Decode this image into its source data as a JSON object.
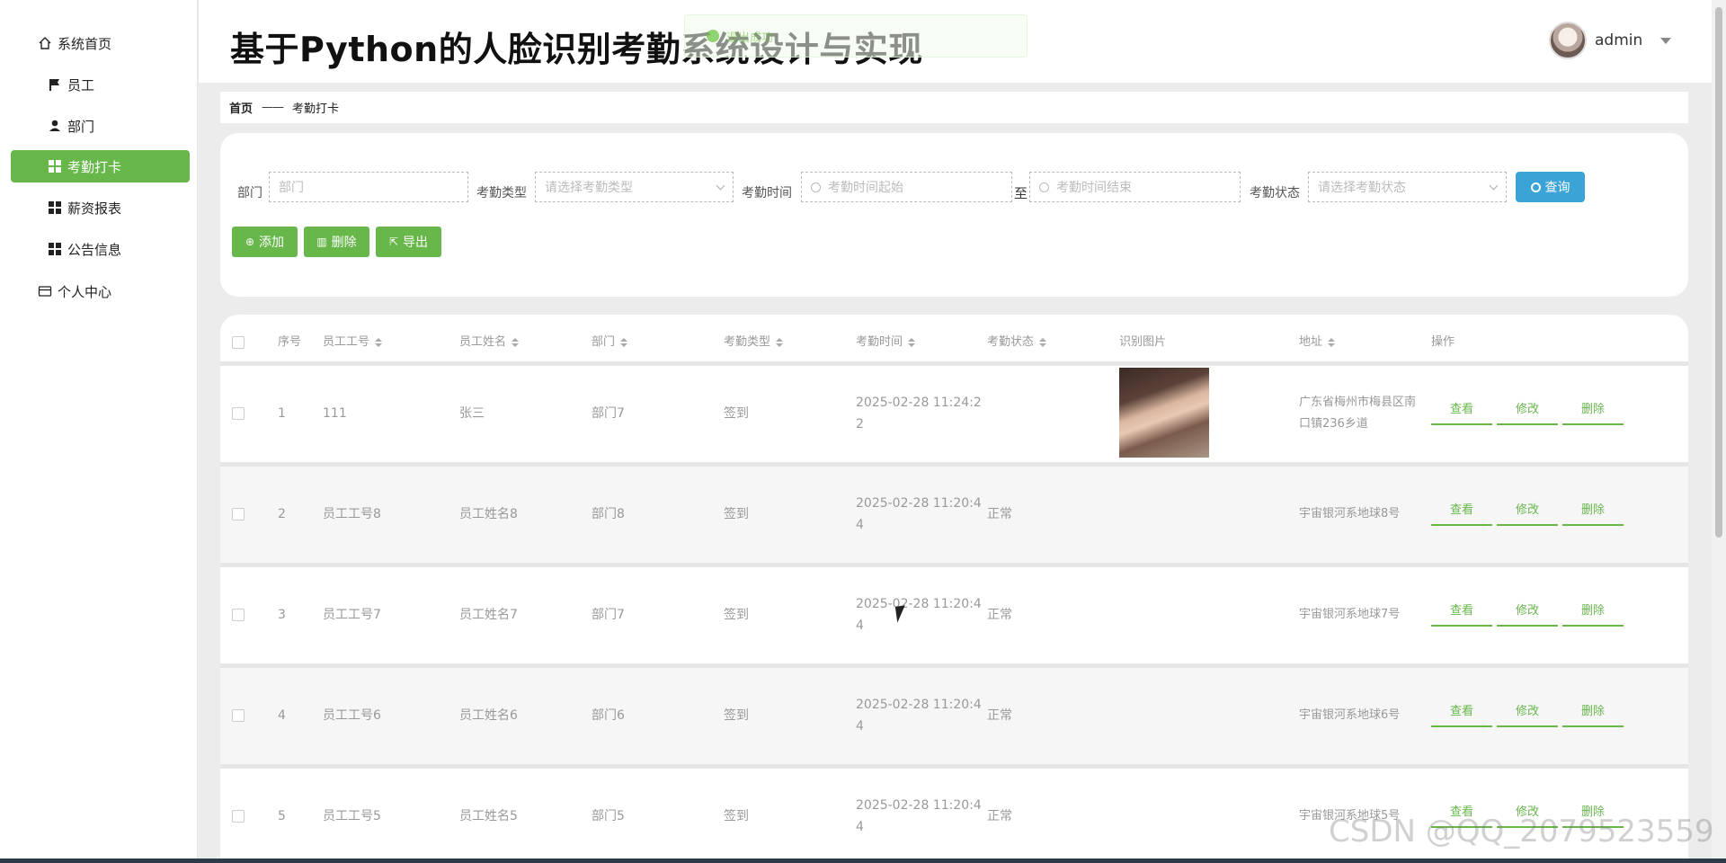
{
  "sidebar": {
    "items": [
      {
        "label": "系统首页",
        "icon": "home-icon"
      },
      {
        "label": "员工",
        "icon": "flag-icon"
      },
      {
        "label": "部门",
        "icon": "user-icon"
      },
      {
        "label": "考勤打卡",
        "icon": "grid-icon",
        "active": true
      },
      {
        "label": "薪资报表",
        "icon": "grid-icon"
      },
      {
        "label": "公告信息",
        "icon": "grid-icon"
      },
      {
        "label": "个人中心",
        "icon": "card-icon"
      }
    ]
  },
  "header": {
    "title": "基于Python的人脸识别考勤系统设计与实现",
    "toast": "退出成功",
    "user": "admin"
  },
  "breadcrumb": {
    "home": "首页",
    "separator": "——",
    "current": "考勤打卡"
  },
  "search": {
    "dept_label": "部门",
    "dept_placeholder": "部门",
    "type_label": "考勤类型",
    "type_placeholder": "请选择考勤类型",
    "time_label": "考勤时间",
    "time_start_placeholder": "考勤时间起始",
    "to": "至",
    "time_end_placeholder": "考勤时间结束",
    "status_label": "考勤状态",
    "status_placeholder": "请选择考勤状态",
    "query": "查询"
  },
  "actions": {
    "add": "添加",
    "delete": "删除",
    "export": "导出"
  },
  "table": {
    "columns": [
      "序号",
      "员工工号",
      "员工姓名",
      "部门",
      "考勤类型",
      "考勤时间",
      "考勤状态",
      "识别图片",
      "地址",
      "操作"
    ],
    "row_actions": [
      "查看",
      "修改",
      "删除"
    ],
    "rows": [
      {
        "no": "1",
        "emp_no": "111",
        "name": "张三",
        "dept": "部门7",
        "type": "签到",
        "time": "2025-02-28 11:24:22",
        "status": "",
        "has_photo": true,
        "addr": "广东省梅州市梅县区南口镇236乡道"
      },
      {
        "no": "2",
        "emp_no": "员工工号8",
        "name": "员工姓名8",
        "dept": "部门8",
        "type": "签到",
        "time": "2025-02-28 11:20:44",
        "status": "正常",
        "has_photo": false,
        "addr": "宇宙银河系地球8号"
      },
      {
        "no": "3",
        "emp_no": "员工工号7",
        "name": "员工姓名7",
        "dept": "部门7",
        "type": "签到",
        "time": "2025-02-28 11:20:44",
        "status": "正常",
        "has_photo": false,
        "addr": "宇宙银河系地球7号"
      },
      {
        "no": "4",
        "emp_no": "员工工号6",
        "name": "员工姓名6",
        "dept": "部门6",
        "type": "签到",
        "time": "2025-02-28 11:20:44",
        "status": "正常",
        "has_photo": false,
        "addr": "宇宙银河系地球6号"
      },
      {
        "no": "5",
        "emp_no": "员工工号5",
        "name": "员工姓名5",
        "dept": "部门5",
        "type": "签到",
        "time": "2025-02-28 11:20:44",
        "status": "正常",
        "has_photo": false,
        "addr": "宇宙银河系地球5号"
      }
    ]
  },
  "watermark": "CSDN @QQ_2079523559"
}
